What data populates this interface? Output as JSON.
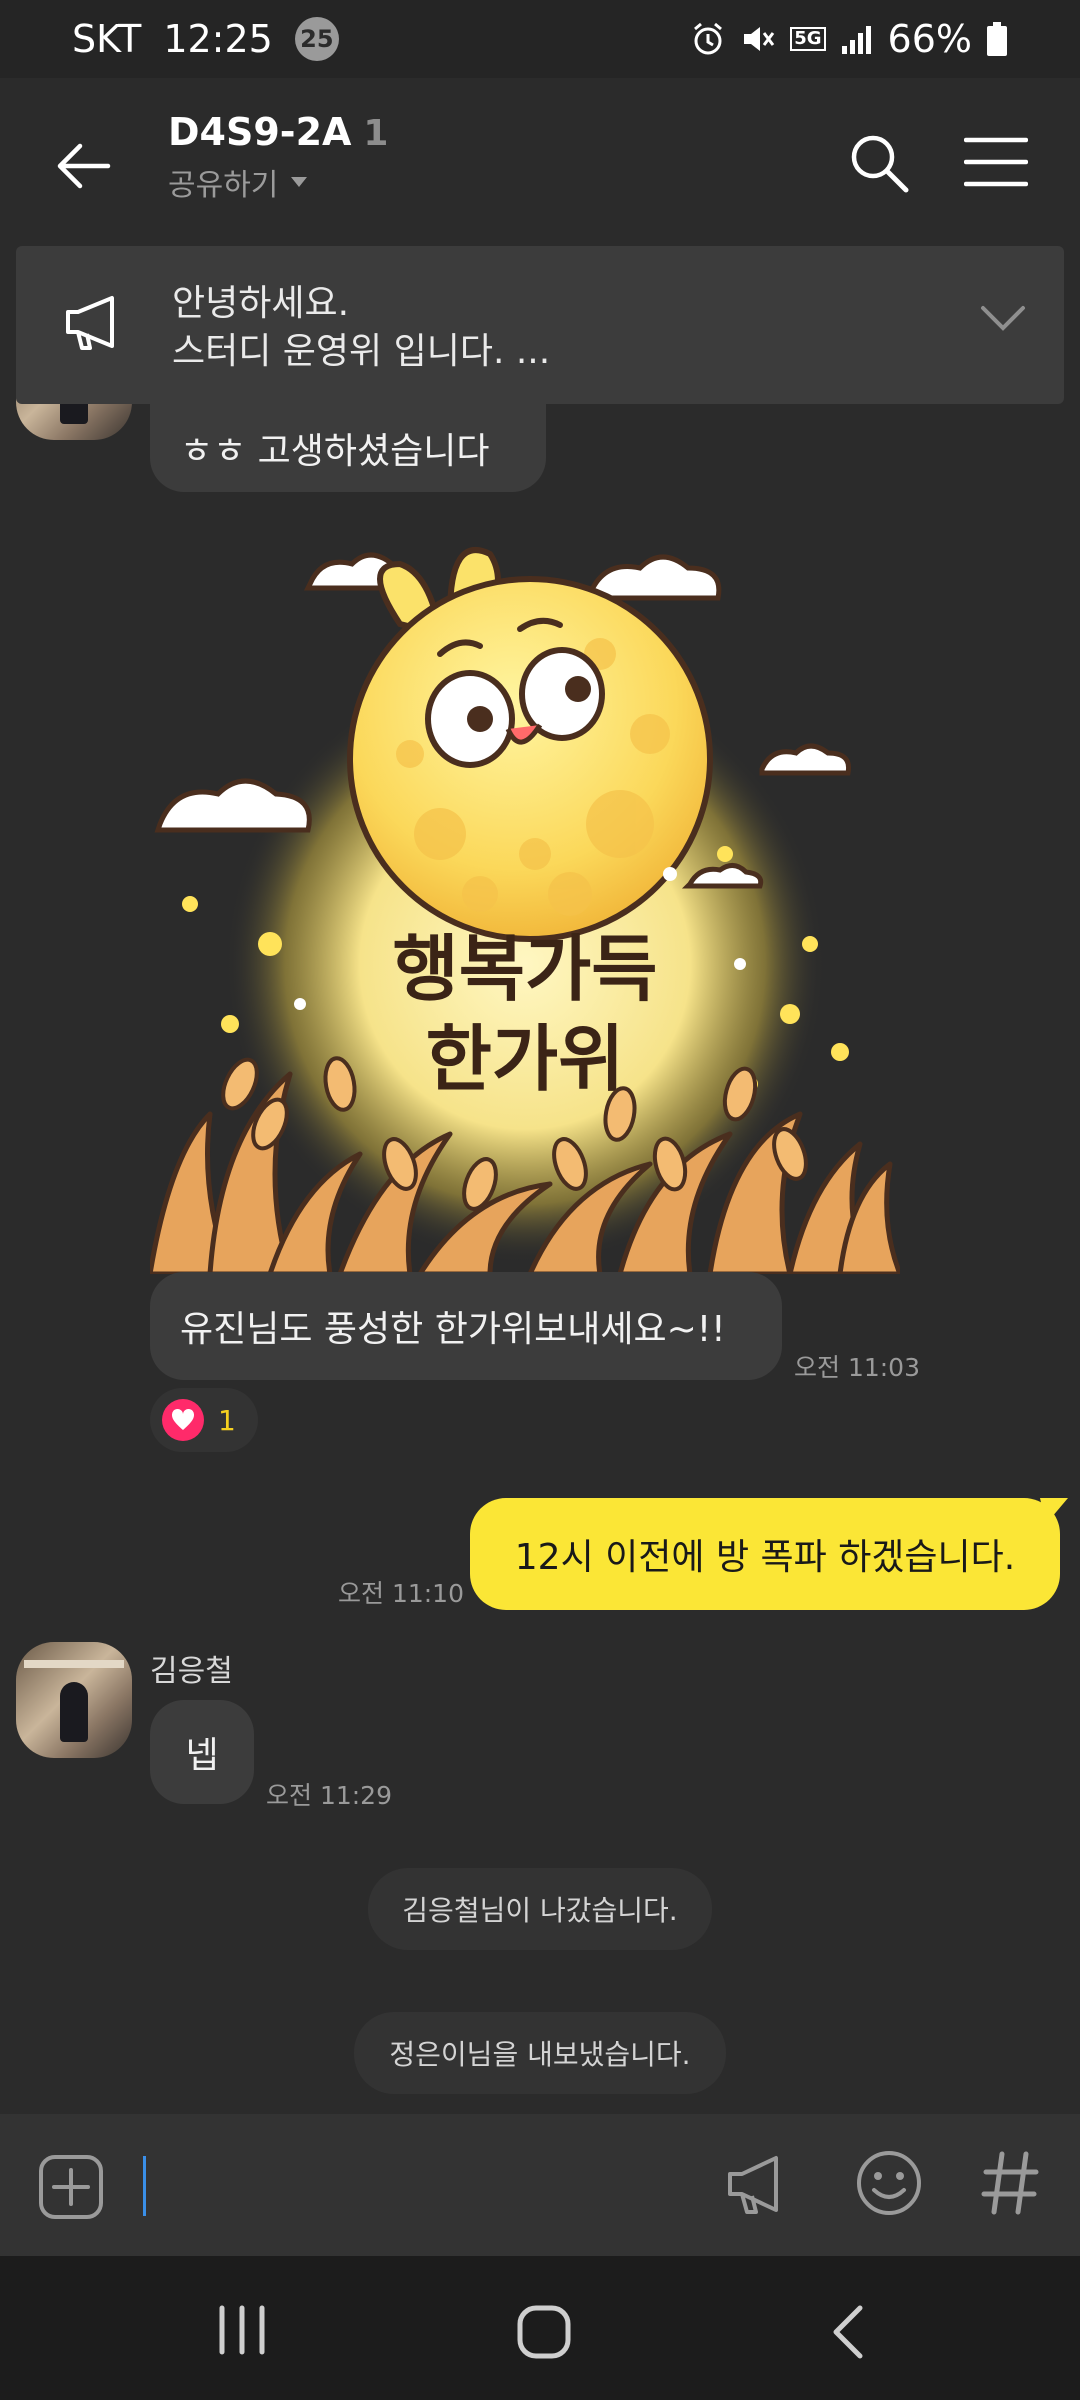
{
  "status_bar": {
    "carrier": "SKT",
    "time": "12:25",
    "notification_count": "25",
    "network": "5G",
    "battery": "66%"
  },
  "header": {
    "title": "D4S9-2A",
    "member_count": "1",
    "share_label": "공유하기"
  },
  "notice": {
    "line1": "안녕하세요.",
    "line2": "스터디 운영위 입니다. ..."
  },
  "messages": {
    "partial_text": "ㅎㅎ 고생하셨습니다",
    "sticker_text_line1": "행복가득",
    "sticker_text_line2": "한가위",
    "reply_text": "유진님도 풍성한 한가위보내세요~!!",
    "reply_time": "오전 11:03",
    "reaction_count": "1",
    "my_text": "12시 이전에 방 폭파 하겠습니다.",
    "my_time": "오전 11:10",
    "sender_name": "김응철",
    "sender_text": "넵",
    "sender_time": "오전 11:29",
    "system1": "김응철님이 나갔습니다.",
    "system2": "정은이님을 내보냈습니다."
  },
  "colors": {
    "background": "#2b2b2b",
    "my_bubble": "#fbe636",
    "other_bubble": "#3c3c3c",
    "reaction_heart": "#ff2a6a"
  }
}
